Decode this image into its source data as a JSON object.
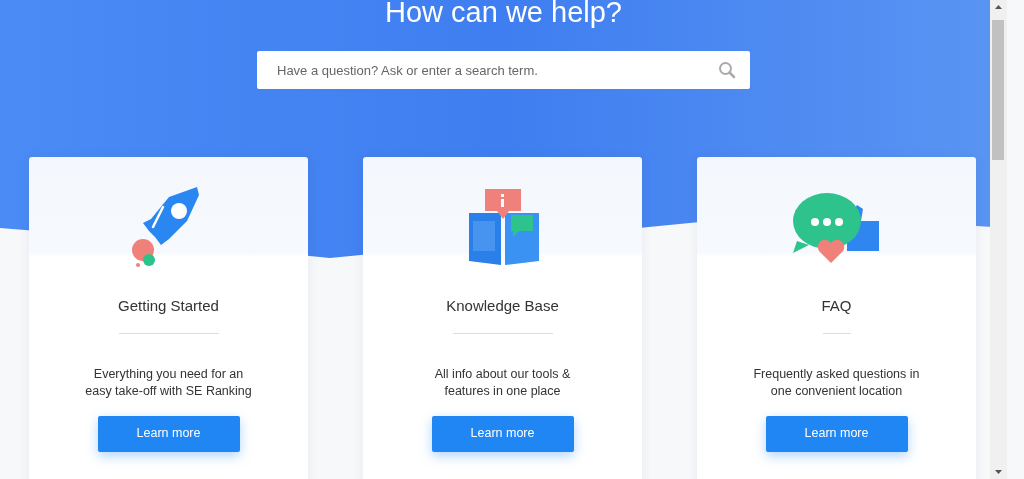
{
  "hero": {
    "title": "How can we help?"
  },
  "search": {
    "placeholder": "Have a question? Ask or enter a search term."
  },
  "cards": [
    {
      "kind": "rocket",
      "title": "Getting Started",
      "description": "Everything you need for an easy take-off with SE Ranking",
      "button": "Learn more"
    },
    {
      "kind": "book",
      "title": "Knowledge Base",
      "description": "All info about our tools & features in one place",
      "button": "Learn more"
    },
    {
      "kind": "chat",
      "title": "FAQ",
      "description": "Frequently asked questions in one convenient location",
      "button": "Learn more"
    }
  ]
}
